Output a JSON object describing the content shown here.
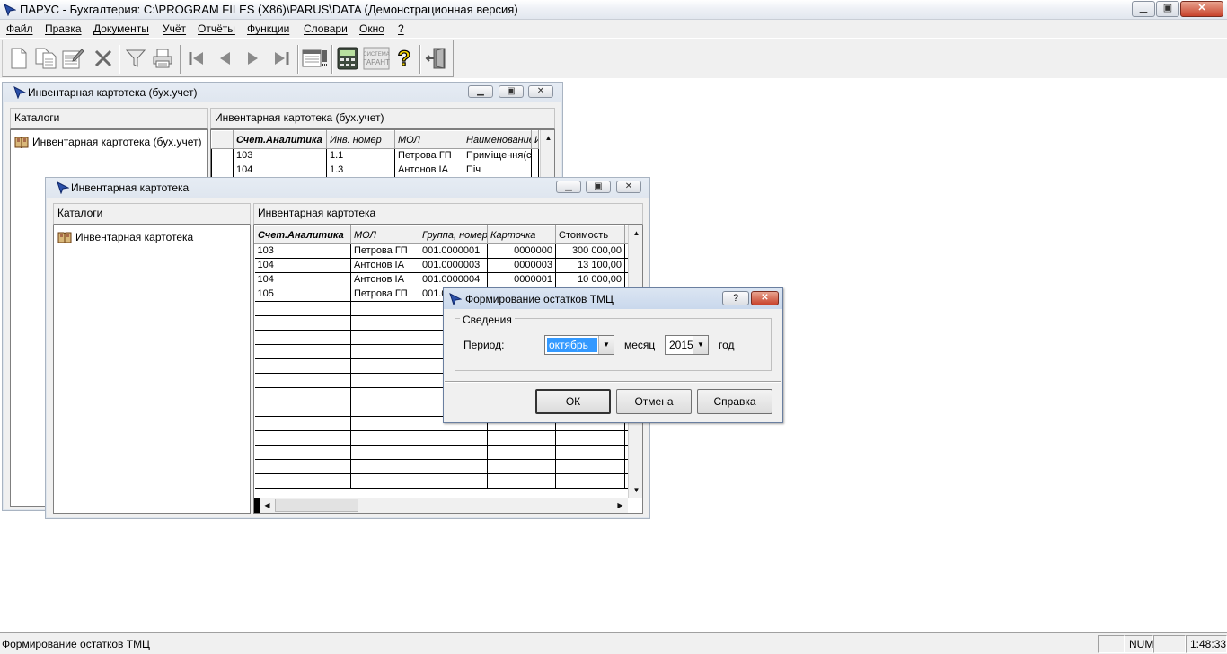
{
  "app": {
    "title": "ПАРУС - Бухгалтерия: C:\\PROGRAM FILES (X86)\\PARUS\\DATA (Демонстрационная версия)",
    "caption_buttons": {
      "minimize": "▁",
      "maximize": "▣",
      "close": "✕"
    }
  },
  "menu": {
    "items": [
      {
        "label": "Файл"
      },
      {
        "label": "Правка"
      },
      {
        "label": "Документы"
      },
      {
        "label": "Учёт"
      },
      {
        "label": "Отчёты"
      },
      {
        "label": "Функции"
      },
      {
        "label": "Словари"
      },
      {
        "label": "Окно"
      },
      {
        "label": "?"
      }
    ]
  },
  "toolbar": {
    "icons": [
      "new-document-icon",
      "copy-document-icon",
      "edit-document-icon",
      "delete-icon",
      "filter-icon",
      "print-icon",
      "first-record-icon",
      "previous-record-icon",
      "next-record-icon",
      "last-record-icon",
      "actions-icon",
      "calculator-icon",
      "garant-icon",
      "help-icon",
      "exit-icon"
    ],
    "garant_text_top": "СИСТЕМА",
    "garant_text_bottom": "ГАРАНТ",
    "help_symbol": "?"
  },
  "window_back": {
    "title": "Инвентарная картотека (бух.учет)",
    "catalogs_header": "Каталоги",
    "tree_item": "Инвентарная картотека (бух.учет)",
    "grid_header": "Инвентарная картотека (бух.учет)",
    "columns": [
      "Счет.Аналитика",
      "Инв. номер",
      "МОЛ",
      "Наименование",
      "И"
    ],
    "rows": [
      [
        "103",
        "1.1",
        "Петрова ГП",
        "Приміщення(с",
        ""
      ],
      [
        "104",
        "1.3",
        "Антонов ІА",
        "Піч",
        ""
      ]
    ]
  },
  "window_front": {
    "title": "Инвентарная картотека",
    "catalogs_header": "Каталоги",
    "tree_item": "Инвентарная картотека",
    "grid_header": "Инвентарная картотека",
    "columns": [
      "Счет.Аналитика",
      "МОЛ",
      "Группа, номер",
      "Карточка",
      "Стоимость",
      "I"
    ],
    "rows": [
      [
        "103",
        "Петрова ГП",
        "001.0000001",
        "0000000",
        "300 000,00"
      ],
      [
        "104",
        "Антонов ІА",
        "001.0000003",
        "0000003",
        "13 100,00"
      ],
      [
        "104",
        "Антонов ІА",
        "001.0000004",
        "0000001",
        "10 000,00"
      ],
      [
        "105",
        "Петрова ГП",
        "001.0",
        "",
        ""
      ]
    ]
  },
  "dialog": {
    "title": "Формирование остатков ТМЦ",
    "help_btn": "?",
    "close_btn": "✕",
    "group_label": "Сведения",
    "period_label": "Период:",
    "month_value": "октябрь",
    "month_unit": "месяц",
    "year_value": "2015",
    "year_unit": "год",
    "ok": "ОК",
    "cancel": "Отмена",
    "help": "Справка"
  },
  "status": {
    "message": "Формирование остатков ТМЦ",
    "num": "NUM",
    "time": "1:48:33"
  }
}
